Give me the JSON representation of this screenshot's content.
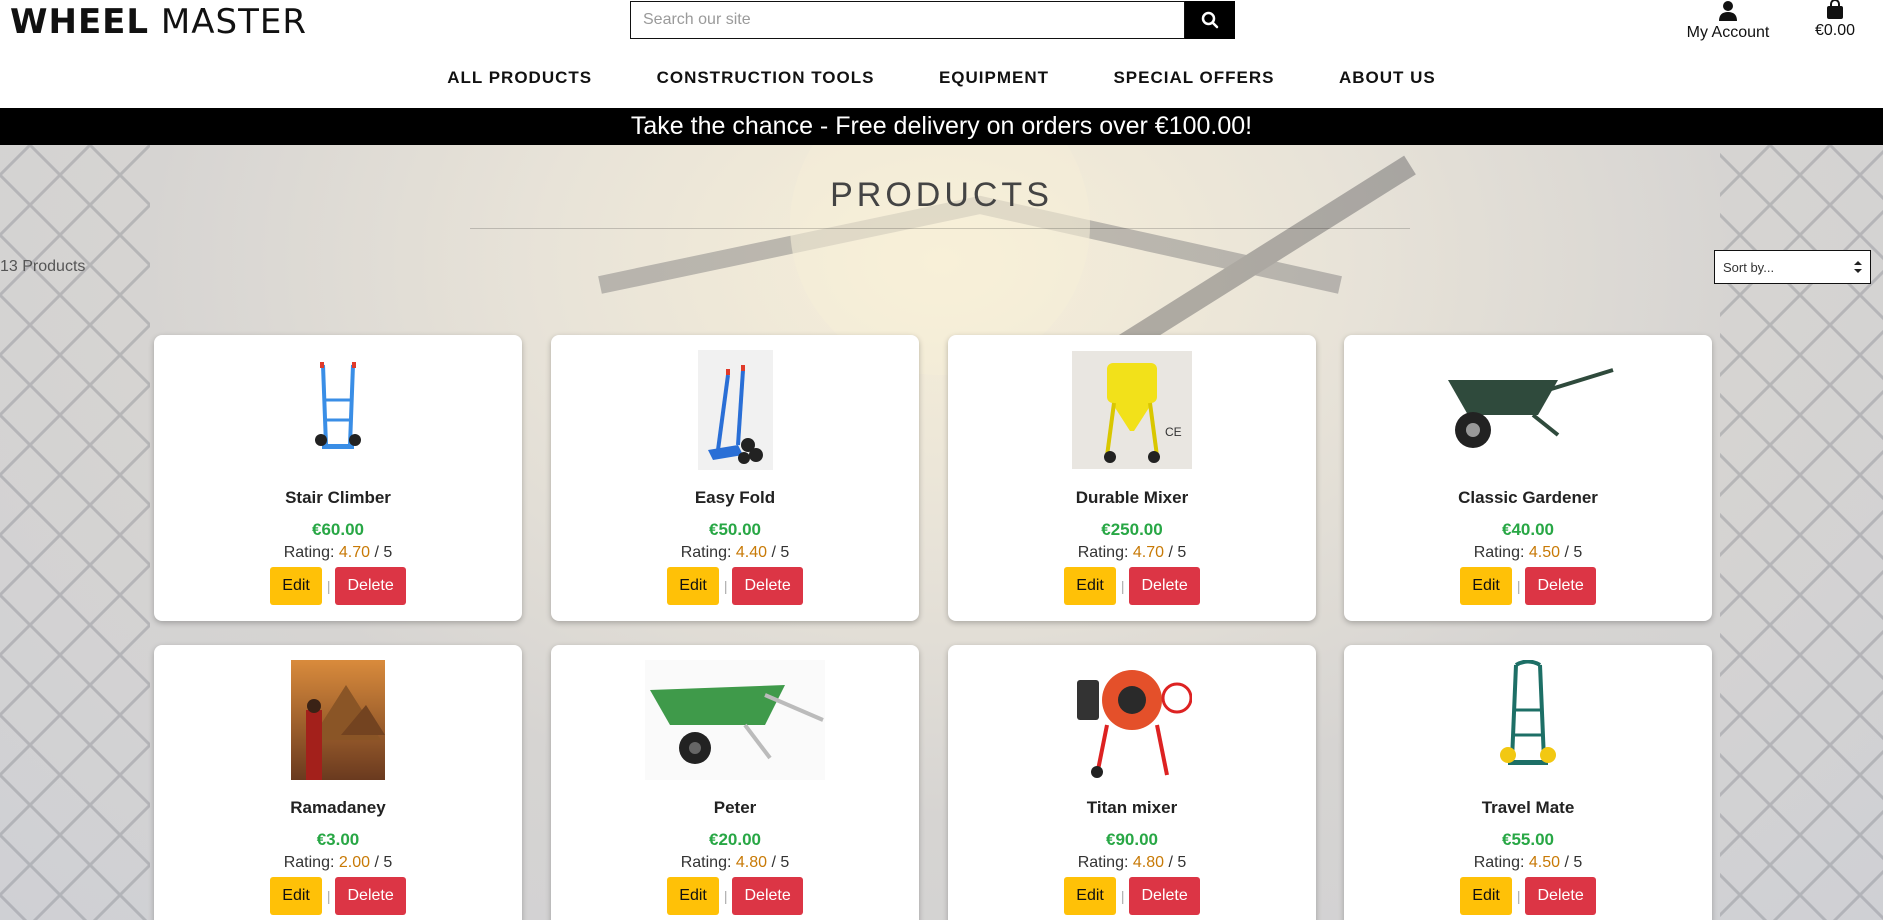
{
  "header": {
    "logo_bold": "WHEEL",
    "logo_light": "MASTER",
    "search_placeholder": "Search our site",
    "account_label": "My Account",
    "cart_total": "€0.00"
  },
  "nav": [
    "ALL PRODUCTS",
    "CONSTRUCTION TOOLS",
    "EQUIPMENT",
    "SPECIAL OFFERS",
    "ABOUT US"
  ],
  "banner": "Take the chance - Free delivery on orders over €100.00!",
  "main": {
    "title": "PRODUCTS",
    "count": "13 Products",
    "sort_label": "Sort by..."
  },
  "product_labels": {
    "rating_prefix": "Rating:",
    "rating_suffix": "/ 5",
    "edit": "Edit",
    "delete": "Delete",
    "sep": "|"
  },
  "products": [
    {
      "name": "Stair Climber",
      "price": "€60.00",
      "rating": "4.70",
      "image": "hand-truck-blue"
    },
    {
      "name": "Easy Fold",
      "price": "€50.00",
      "rating": "4.40",
      "image": "stair-trolley-blue"
    },
    {
      "name": "Durable Mixer",
      "price": "€250.00",
      "rating": "4.70",
      "image": "yellow-mixer"
    },
    {
      "name": "Classic Gardener",
      "price": "€40.00",
      "rating": "4.50",
      "image": "wheelbarrow-dark-green"
    },
    {
      "name": "Ramadaney",
      "price": "€3.00",
      "rating": "2.00",
      "image": "pyramid-painting"
    },
    {
      "name": "Peter",
      "price": "€20.00",
      "rating": "4.80",
      "image": "wheelbarrow-green"
    },
    {
      "name": "Titan mixer",
      "price": "€90.00",
      "rating": "4.80",
      "image": "orange-cement-mixer"
    },
    {
      "name": "Travel Mate",
      "price": "€55.00",
      "rating": "4.50",
      "image": "hand-truck-teal"
    }
  ],
  "colors": {
    "price": "#28a745",
    "rating": "#c87a06",
    "edit": "#ffc107",
    "delete": "#dc3545",
    "banner": "#000000"
  }
}
